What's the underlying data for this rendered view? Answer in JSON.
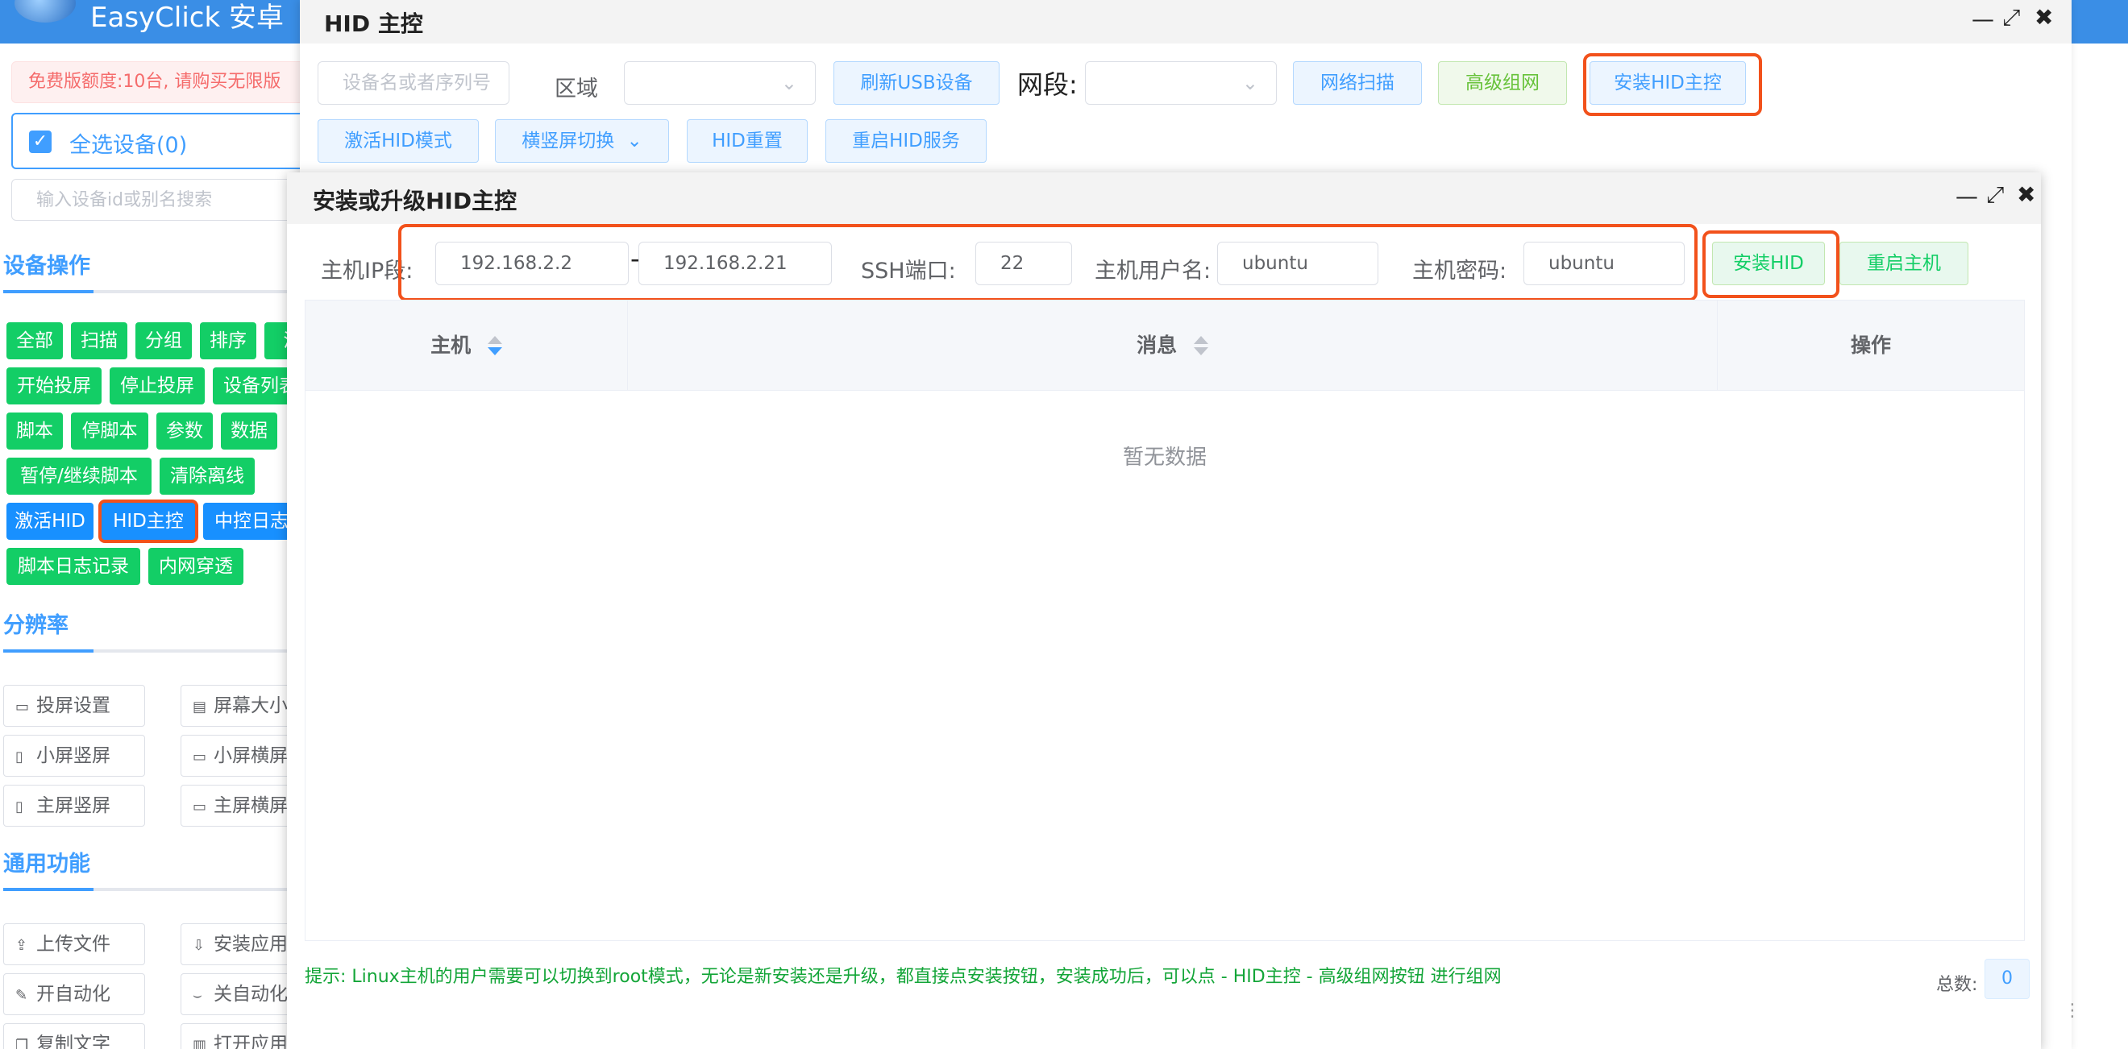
{
  "app": {
    "title": "EasyClick 安卓"
  },
  "left_panel": {
    "alert": "免费版额度:10台, 请购买无限版",
    "select_all": "全选设备(0)",
    "search_placeholder": "输入设备id或别名搜索",
    "section_device_ops": "设备操作",
    "ops_buttons": [
      "全部",
      "扫描",
      "分组",
      "排序",
      "清",
      "开始投屏",
      "停止投屏",
      "设备列表",
      "脚本",
      "停脚本",
      "参数",
      "数据",
      "暂停/继续脚本",
      "清除离线",
      "激活HID",
      "HID主控",
      "中控日志",
      "脚本日志记录",
      "内网穿透"
    ],
    "section_resolution": "分辨率",
    "resolution_buttons": [
      "投屏设置",
      "屏幕大小",
      "小屏竖屏",
      "小屏横屏",
      "主屏竖屏",
      "主屏横屏"
    ],
    "section_common": "通用功能",
    "common_buttons": [
      "上传文件",
      "安装应用",
      "开自动化",
      "关自动化",
      "复制文字",
      "打开应用"
    ]
  },
  "hid_dialog": {
    "title": "HID 主控",
    "device_placeholder": "设备名或者序列号",
    "region_label": "区域",
    "refresh_usb": "刷新USB设备",
    "segment_label": "网段:",
    "network_scan": "网络扫描",
    "advanced_network": "高级组网",
    "install_hid_master": "安装HID主控",
    "activate_hid_mode": "激活HID模式",
    "orientation_switch": "横竖屏切换",
    "hid_reset": "HID重置",
    "restart_hid_service": "重启HID服务"
  },
  "install_dialog": {
    "title": "安装或升级HID主控",
    "ip_label": "主机IP段:",
    "ip_start": "192.168.2.2",
    "ip_dash": "-",
    "ip_end": "192.168.2.21",
    "ssh_label": "SSH端口:",
    "ssh_port": "22",
    "user_label": "主机用户名:",
    "username": "ubuntu",
    "pass_label": "主机密码:",
    "password": "ubuntu",
    "install_button": "安装HID",
    "restart_button": "重启主机",
    "table": {
      "columns": [
        "主机",
        "消息",
        "操作"
      ],
      "empty_text": "暂无数据"
    },
    "tip": "提示: Linux主机的用户需要可以切换到root模式，无论是新安装还是升级，都直接点安装按钮，安装成功后，可以点 - HID主控 - 高级组网按钮 进行组网",
    "total_label": "总数:",
    "total_count": "0"
  },
  "colors": {
    "accent": "#409eff",
    "green": "#13ce66",
    "highlight": "#f2511b"
  },
  "icons": [
    "window-minimize-icon",
    "window-maximize-icon",
    "window-close-icon",
    "checkbox-checked-icon",
    "chevron-down-icon",
    "sort-icon"
  ]
}
